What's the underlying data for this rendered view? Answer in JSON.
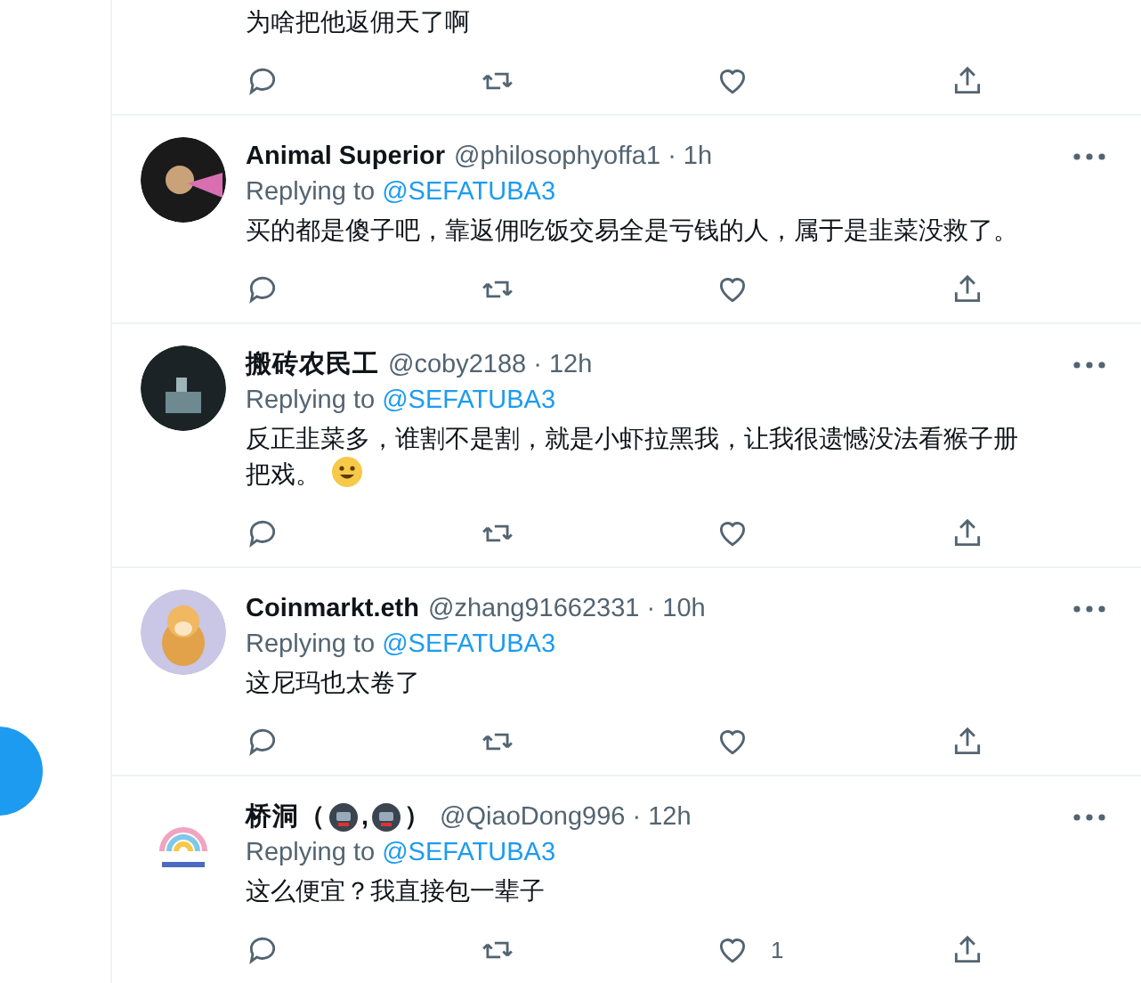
{
  "tweets": [
    {
      "partial": true,
      "text": "为啥把他返佣天了啊"
    },
    {
      "partial": false,
      "name_parts": [
        "Animal Superior"
      ],
      "handle": "@philosophyoffa1 · 1h",
      "replying_label": "Replying to",
      "replying_to": "@SEFATUBA3",
      "text": "买的都是傻子吧，靠返佣吃饭交易全是亏钱的人，属于是韭菜没救了。",
      "trailing_emoji": false
    },
    {
      "partial": false,
      "name_parts": [
        "搬砖农民工"
      ],
      "handle": "@coby2188 · 12h",
      "replying_label": "Replying to",
      "replying_to": "@SEFATUBA3",
      "text": "反正韭菜多，谁割不是割，就是小虾拉黑我，让我很遗憾没法看猴子册把戏。",
      "trailing_emoji": true
    },
    {
      "partial": false,
      "name_parts": [
        "Coinmarkt.eth"
      ],
      "handle": "@zhang91662331 · 10h",
      "replying_label": "Replying to",
      "replying_to": "@SEFATUBA3",
      "text": "这尼玛也太卷了",
      "trailing_emoji": false
    },
    {
      "partial": false,
      "name_parts": [
        "桥洞（",
        ",",
        "）"
      ],
      "handle": "@QiaoDong996 · 12h",
      "replying_label": "Replying to",
      "replying_to": "@SEFATUBA3",
      "text": "这么便宜？我直接包一辈子",
      "trailing_emoji": false,
      "like_count": "1"
    }
  ]
}
